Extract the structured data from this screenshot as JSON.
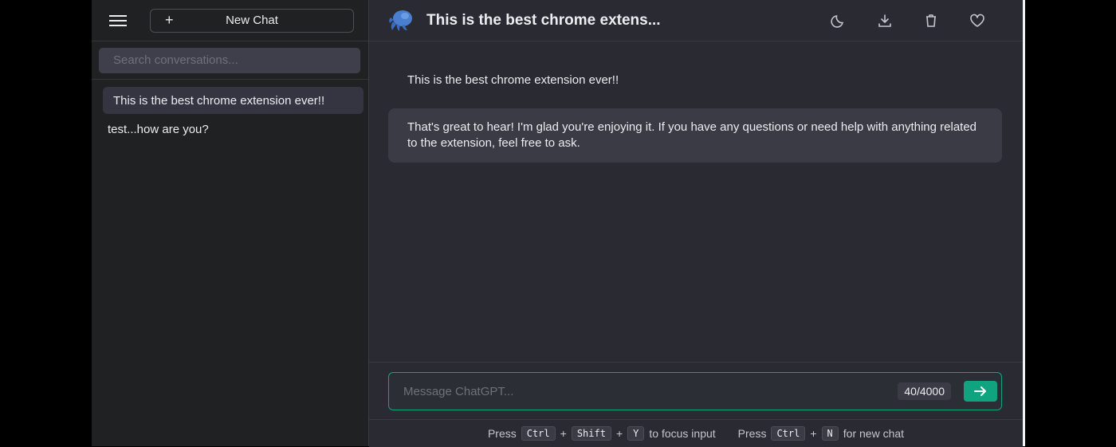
{
  "sidebar": {
    "new_chat_label": "New Chat",
    "search_placeholder": "Search conversations...",
    "conversations": [
      {
        "title": "This is the best chrome extension ever!!",
        "active": true
      },
      {
        "title": "test...how are you?",
        "active": false
      }
    ]
  },
  "header": {
    "title": "This is the best chrome extens...",
    "icons": [
      "moon-icon",
      "download-icon",
      "trash-icon",
      "heart-icon"
    ]
  },
  "messages": [
    {
      "role": "user",
      "text": "This is the best chrome extension ever!!"
    },
    {
      "role": "assistant",
      "text": "That's great to hear! I'm glad you're enjoying it. If you have any questions or need help with anything related to the extension, feel free to ask."
    }
  ],
  "composer": {
    "placeholder": "Message ChatGPT...",
    "counter": "40/4000"
  },
  "hints": {
    "press1": "Press",
    "ctrl1": "Ctrl",
    "plus1": "+",
    "shift": "Shift",
    "plus2": "+",
    "y": "Y",
    "focus_text": "to focus input",
    "press2": "Press",
    "ctrl2": "Ctrl",
    "plus3": "+",
    "n": "N",
    "newchat_text": "for new chat"
  },
  "colors": {
    "accent": "#10a37f",
    "sidebar_bg": "#202123",
    "main_bg": "#2a2b32"
  }
}
